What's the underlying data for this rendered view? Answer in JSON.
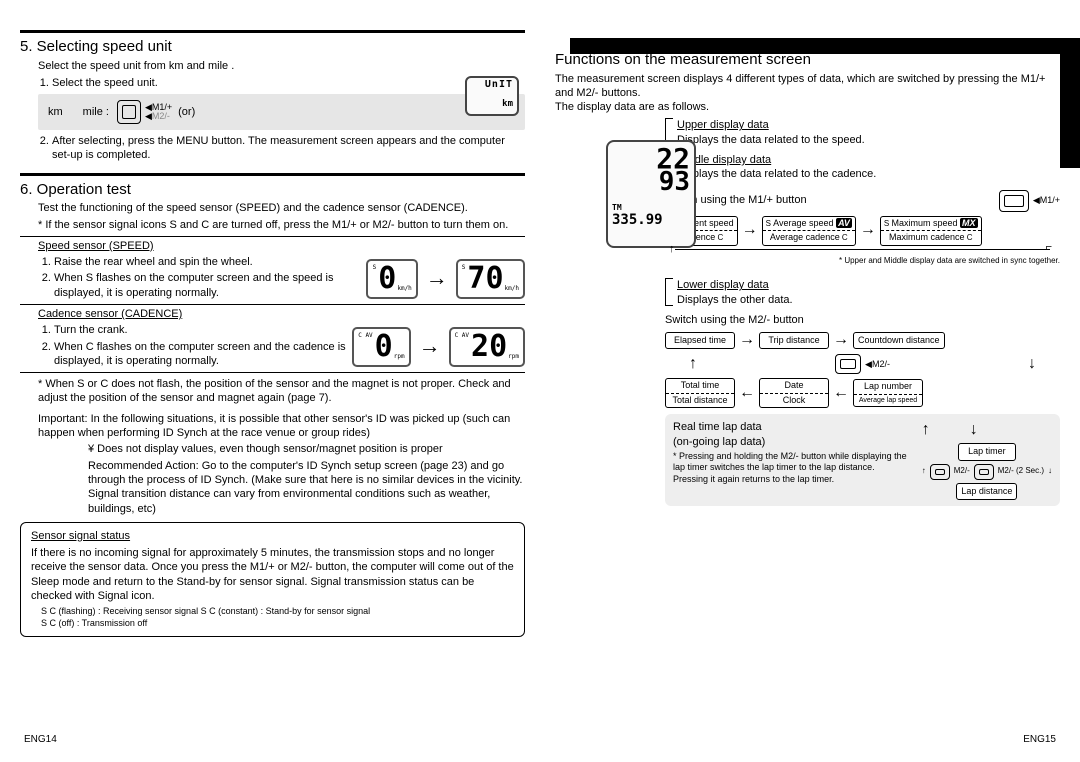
{
  "left": {
    "h5": "5. Selecting speed unit",
    "h5_sub": "Select the speed unit from km and mile .",
    "h5_step1": "Select the speed unit.",
    "gray": {
      "km": "km",
      "mile": "mile :",
      "m1": "M1/+",
      "m2": "M2/-",
      "or": "(or)"
    },
    "lcd_unit": {
      "top": "UnIT",
      "bot": "km"
    },
    "h5_step2": "After selecting, press the MENU button. The measurement screen appears and the computer set-up is completed.",
    "h6": "6. Operation test",
    "h6_sub": "Test the functioning of the speed sensor (SPEED) and the cadence sensor (CADENCE).",
    "h6_note": "* If the sensor signal icons S and C are turned off, press the M1/+ or M2/- button to turn them on.",
    "speed_h": "Speed sensor (SPEED)",
    "speed_1": "Raise the rear wheel and spin the wheel.",
    "speed_2": "When S flashes on the computer screen and the speed is displayed, it is operating normally.",
    "speed_lcd_a": "0",
    "speed_lcd_b": "70",
    "cad_h": "Cadence sensor (CADENCE)",
    "cad_1": "Turn the crank.",
    "cad_2": "When C flashes on the computer screen and the cadence is displayed, it is operating normally.",
    "cad_lcd_a": "0",
    "cad_lcd_b": "20",
    "starnote": "* When S or C does not flash, the position of the sensor and the magnet is not proper. Check and adjust the position of the sensor and magnet again (page 7).",
    "important_label": "Important:",
    "important": "In the following situations, it is possible that other sensor's ID was picked up (such can happen when performing ID Synch at the race venue or group rides)",
    "imp_b1": "¥  Does not display values, even though sensor/magnet position is proper",
    "imp_action_label": "Recommended Action:",
    "imp_action": "Go to the computer's ID Synch setup screen (page 23) and go through the process of ID Synch. (Make sure that here is no similar devices in the vicinity.  Signal transition distance can vary from environmental conditions such as weather, buildings, etc)",
    "sss_h": "Sensor signal status",
    "sss_p": "If there is no incoming signal for approximately 5 minutes, the transmission stops and no longer receive the sensor data. Once you press the M1/+ or M2/- button, the computer will come out of the Sleep mode and return to the Stand-by for sensor signal. Signal transmission status can be checked with Signal icon.",
    "sss_l1": "S C (flashing) : Receiving sensor signal  S C (constant) : Stand-by for sensor signal",
    "sss_l2": "S C (off) : Transmission off"
  },
  "right": {
    "h": "Functions on the measurement screen",
    "p1": "The measurement screen displays 4 different types of data, which are switched by pressing the M1/+ and M2/- buttons.",
    "p2": "The display data are as follows.",
    "big": {
      "r1": "22",
      "r2": "93",
      "r3a": "TM",
      "r3b": "335.99"
    },
    "upper_h": "Upper display data",
    "upper_p": "Displays the data related to the speed.",
    "middle_h": "Middle display data",
    "middle_p": "Displays the data related to the cadence.",
    "sw_upper": "Switch using the M1/+ button",
    "m1": "M1/+",
    "f1": {
      "a_t": "Current speed",
      "a_b": "Cadence",
      "b_t": "Average speed",
      "b_b": "Average cadence",
      "c_t": "Maximum speed",
      "c_b": "Maximum cadence",
      "av": "AV",
      "mx": "MX"
    },
    "sync_note": "* Upper and Middle display data are switched in sync together.",
    "lower_h": "Lower display data",
    "lower_p": "Displays the other data.",
    "sw_lower": "Switch using the M2/- button",
    "m2": "M2/-",
    "f2": {
      "elapsed": "Elapsed time",
      "trip": "Trip distance",
      "countdown": "Countdown distance",
      "total_t": "Total time",
      "total_d": "Total distance",
      "date": "Date",
      "clock": "Clock",
      "lapnum": "Lap number",
      "avglap": "Average lap speed",
      "laptimer": "Lap timer",
      "lapdist": "Lap distance"
    },
    "real_h": "Real time lap data",
    "real_sub": "(on-going lap data)",
    "real_note": "* Pressing and holding the M2/- button while displaying the lap timer switches the lap timer to the lap distance. Pressing it again returns to the lap timer.",
    "btn_m2": "M2/-",
    "btn_m2_hold": "M2/- (2 Sec.)"
  },
  "footer": {
    "left": "ENG14",
    "right": "ENG15"
  }
}
